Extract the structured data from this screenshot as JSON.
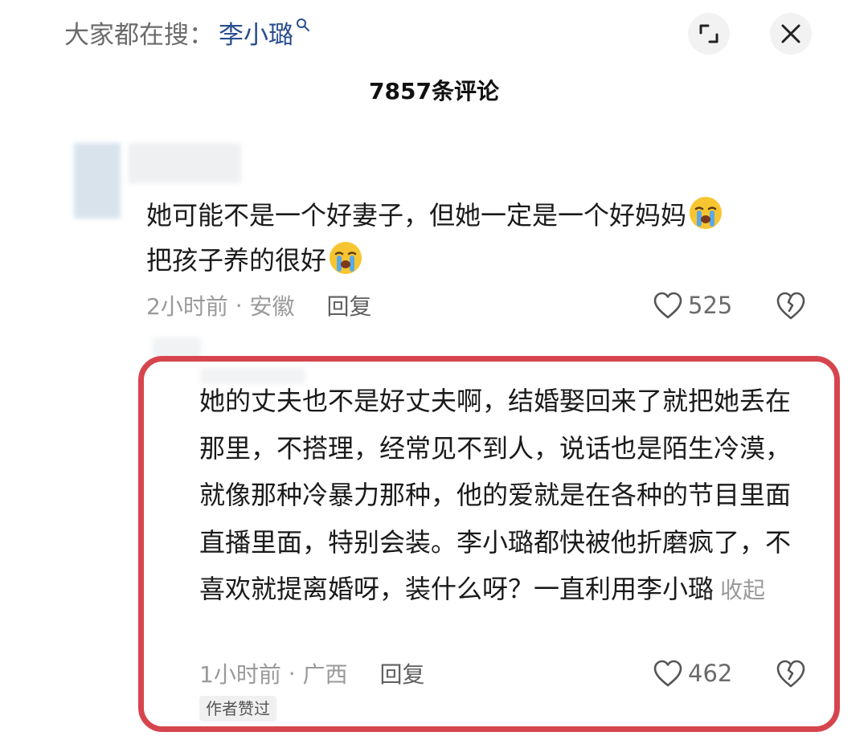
{
  "header": {
    "search_prefix": "大家都在搜：",
    "search_term": "李小璐",
    "comment_count": "7857条评论"
  },
  "icons": {
    "search": "search-icon",
    "expand": "expand-icon",
    "close": "close-icon",
    "like": "heart-icon",
    "dislike": "broken-heart-icon",
    "emoji": "crying-face-emoji"
  },
  "comments": [
    {
      "text_line1": "她可能不是一个好妻子，但她一定是一个好妈妈",
      "text_line2": "把孩子养的很好",
      "time": "2小时前",
      "location": "安徽",
      "reply_label": "回复",
      "likes": "525"
    },
    {
      "text": "她的丈夫也不是好丈夫啊，结婚娶回来了就把她丢在那里，不搭理，经常见不到人，说话也是陌生冷漠，就像那种冷暴力那种，他的爱就是在各种的节目里面直播里面，特别会装。李小璐都快被他折磨疯了，不喜欢就提离婚呀，装什么呀？一直利用李小璐",
      "collapse_label": "收起",
      "time": "1小时前",
      "location": "广西",
      "reply_label": "回复",
      "likes": "462",
      "author_badge": "作者赞过"
    }
  ],
  "colors": {
    "highlight_border": "#d6454d",
    "search_term": "#2a4d8f",
    "muted_text": "#9a9a9a"
  }
}
